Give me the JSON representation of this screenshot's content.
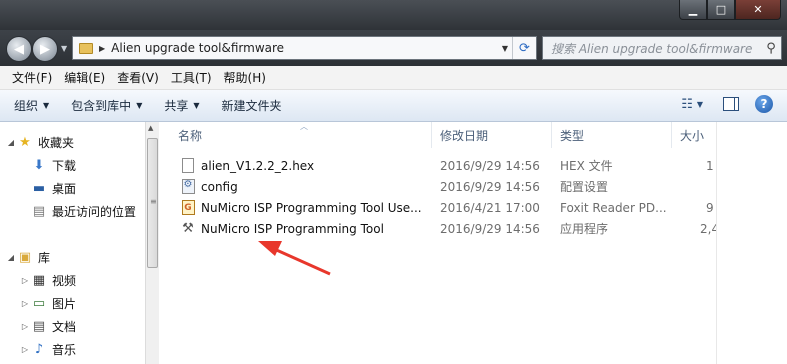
{
  "window": {
    "minimize_glyph": "▁",
    "maximize_glyph": "□",
    "close_glyph": "✕"
  },
  "address_bar": {
    "path": "Alien upgrade tool&firmware",
    "search_placeholder": "搜索 Alien upgrade tool&firmware"
  },
  "menu": [
    "文件(F)",
    "编辑(E)",
    "查看(V)",
    "工具(T)",
    "帮助(H)"
  ],
  "toolbar": {
    "organize": "组织",
    "include_in_library": "包含到库中",
    "share": "共享",
    "new_folder": "新建文件夹"
  },
  "nav_pane": {
    "favorites": {
      "label": "收藏夹",
      "items": [
        "下载",
        "桌面",
        "最近访问的位置"
      ]
    },
    "libraries": {
      "label": "库",
      "items": [
        "视频",
        "图片",
        "文档",
        "音乐"
      ]
    }
  },
  "file_list": {
    "columns": {
      "name": "名称",
      "date": "修改日期",
      "type": "类型",
      "size": "大小"
    },
    "rows": [
      {
        "name": "alien_V1.2.2_2.hex",
        "date": "2016/9/29 14:56",
        "type": "HEX 文件",
        "size": "1",
        "icon": "document-icon"
      },
      {
        "name": "config",
        "date": "2016/9/29 14:56",
        "type": "配置设置",
        "size": "",
        "icon": "config-file-icon"
      },
      {
        "name": "NuMicro ISP Programming Tool Use...",
        "date": "2016/4/21 17:00",
        "type": "Foxit Reader PD...",
        "size": "9",
        "icon": "pdf-icon"
      },
      {
        "name": "NuMicro ISP Programming Tool",
        "date": "2016/9/29 14:56",
        "type": "应用程序",
        "size": "2,4",
        "icon": "application-icon"
      }
    ]
  },
  "colors": {
    "annotation_arrow": "#e8372c",
    "title_bar": "#3a3f45",
    "command_bar": "#e3ecf6"
  }
}
